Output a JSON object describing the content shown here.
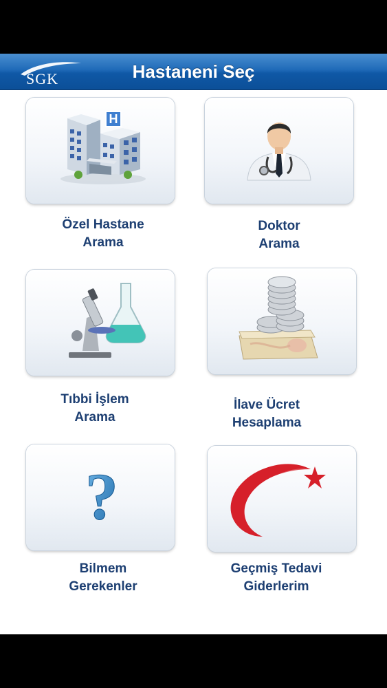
{
  "header": {
    "logo_text": "SGK",
    "title": "Hastaneni Seç"
  },
  "menu": [
    {
      "id": "ozel-hastane-arama",
      "line1": "Özel Hastane",
      "line2": "Arama",
      "icon": "hospital-icon"
    },
    {
      "id": "doktor-arama",
      "line1": "Doktor",
      "line2": "Arama",
      "icon": "doctor-icon"
    },
    {
      "id": "tibbi-islem-arama",
      "line1": "Tıbbi İşlem",
      "line2": "Arama",
      "icon": "microscope-icon"
    },
    {
      "id": "ilave-ucret-hesaplama",
      "line1": "İlave Ücret",
      "line2": "Hesaplama",
      "icon": "money-icon"
    },
    {
      "id": "bilmem-gerekenler",
      "line1": "Bilmem",
      "line2": "Gerekenler",
      "icon": "question-icon"
    },
    {
      "id": "gecmis-tedavi-giderlerim",
      "line1": "Geçmiş Tedavi",
      "line2": "Giderlerim",
      "icon": "crescent-star-icon"
    }
  ],
  "colors": {
    "navbar": "#1f6ab8",
    "label": "#1d3f72",
    "crescent": "#d6202a"
  }
}
